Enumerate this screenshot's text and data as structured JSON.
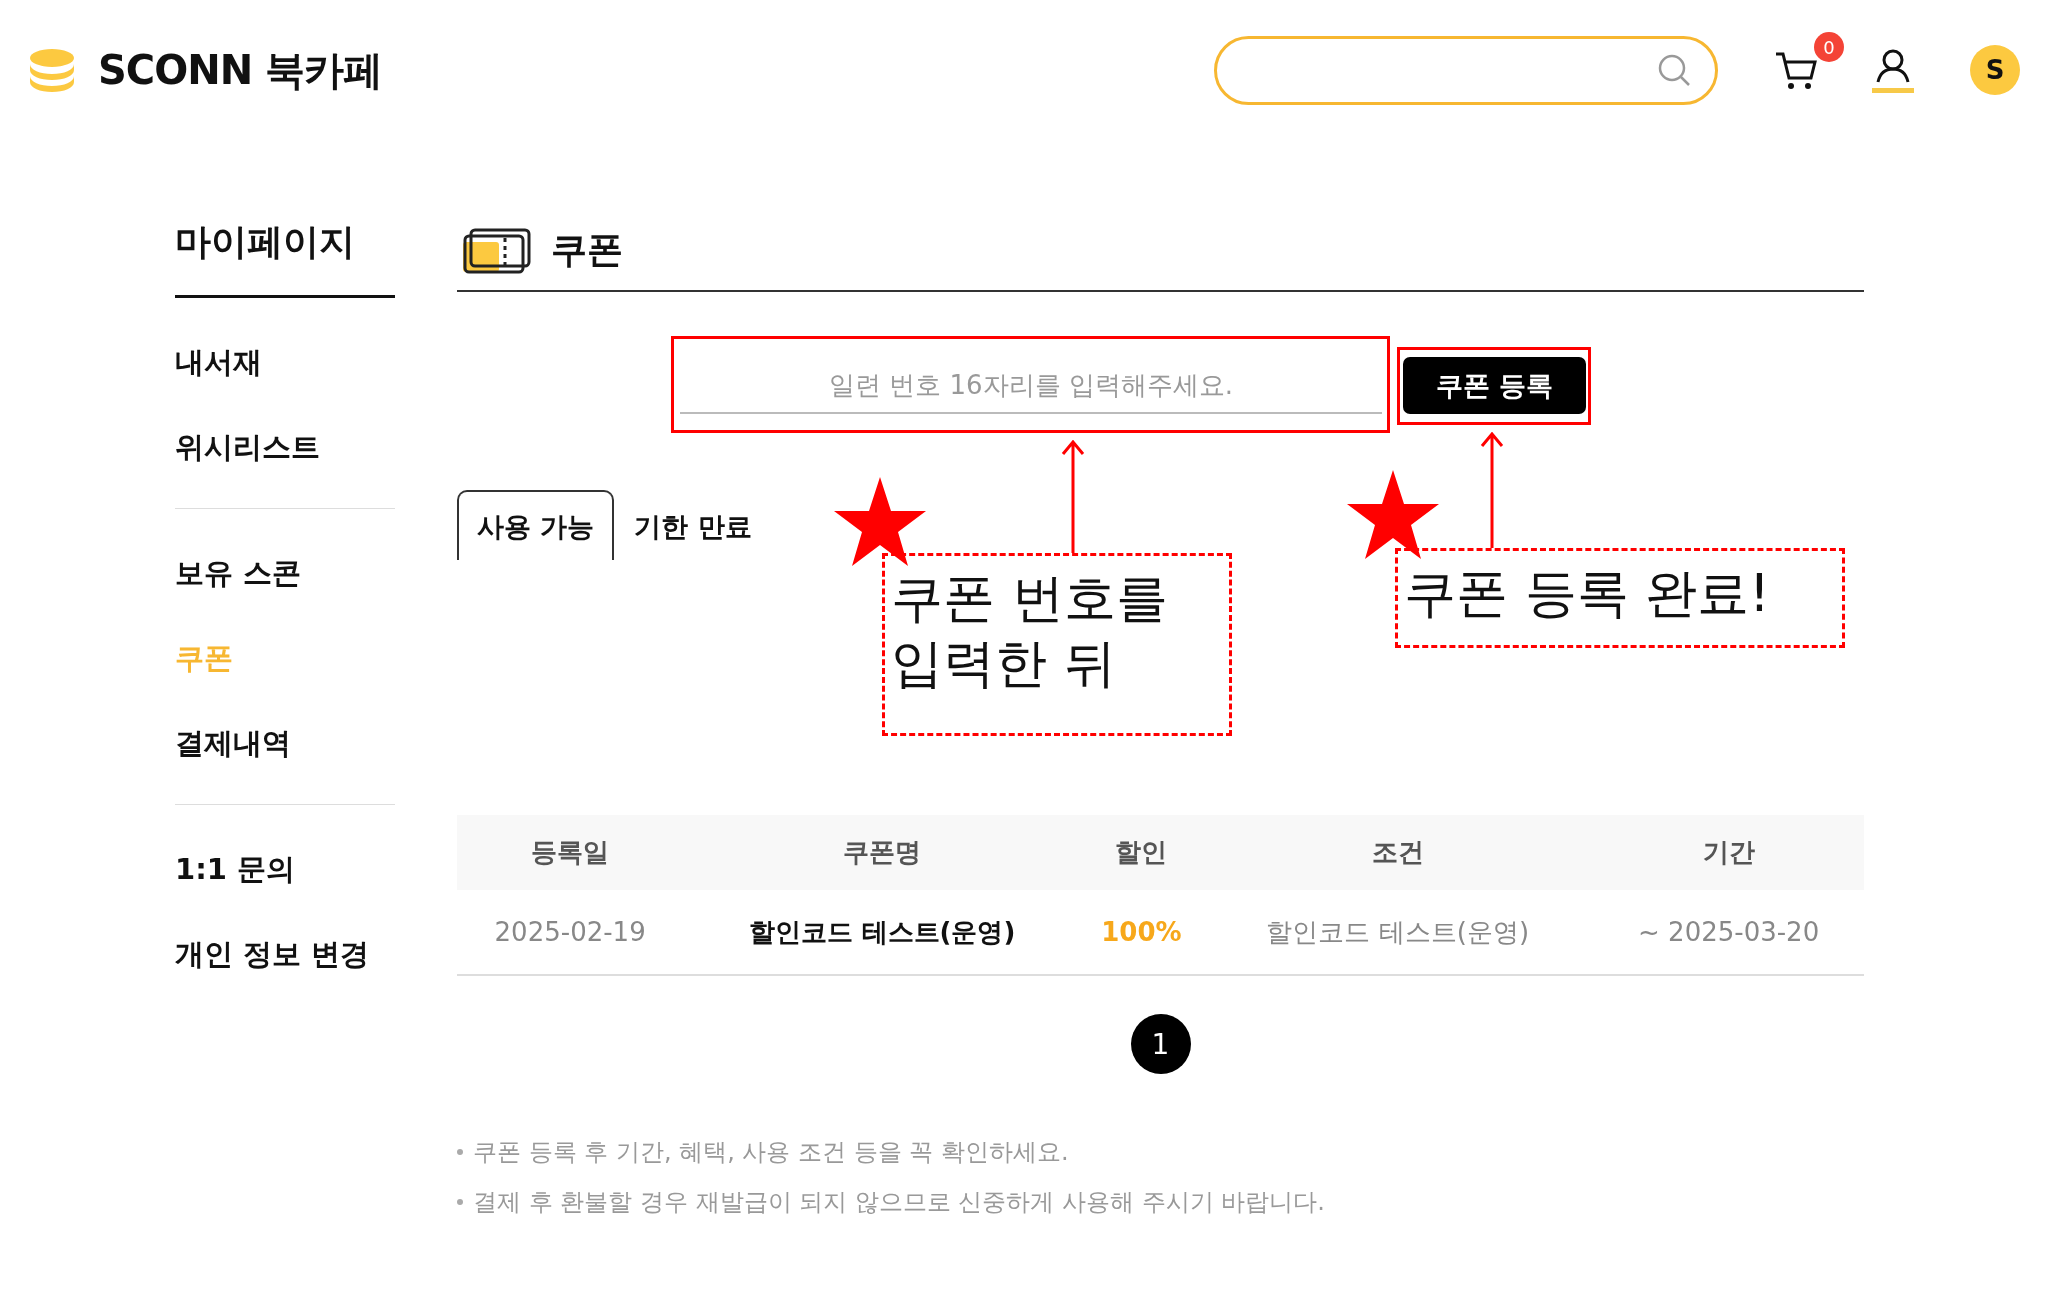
{
  "header": {
    "logo": "SCONN 북카페",
    "cart_count": "0",
    "avatar": "S"
  },
  "sidebar": {
    "title": "마이페이지",
    "groups": [
      [
        {
          "label": "내서재",
          "selected": false
        },
        {
          "label": "위시리스트",
          "selected": false
        }
      ],
      [
        {
          "label": "보유 스콘",
          "selected": false
        },
        {
          "label": "쿠폰",
          "selected": true
        },
        {
          "label": "결제내역",
          "selected": false
        }
      ],
      [
        {
          "label": "1:1 문의",
          "selected": false
        },
        {
          "label": "개인 정보 변경",
          "selected": false
        }
      ]
    ]
  },
  "page_title": "쿠폰",
  "coupon_form": {
    "placeholder": "일련 번호 16자리를 입력해주세요.",
    "button": "쿠폰 등록"
  },
  "tabs": [
    {
      "label": "사용 가능",
      "selected": true
    },
    {
      "label": "기한 만료",
      "selected": false
    }
  ],
  "table": {
    "columns": [
      "등록일",
      "쿠폰명",
      "할인",
      "조건",
      "기간"
    ],
    "rows": [
      {
        "cells": [
          "2025-02-19",
          "할인코드 테스트(운영)",
          "100%",
          "할인코드 테스트(운영)",
          "~ 2025-03-20"
        ]
      }
    ]
  },
  "pagination": [
    {
      "label": "1",
      "selected": true
    }
  ],
  "notes": [
    "쿠폰 등록 후 기간, 혜택, 사용 조건 등을 꼭 확인하세요.",
    "결제 후 환불할 경우 재발급이 되지 않으므로 신중하게 사용해 주시기 바랍니다."
  ],
  "annotations": [
    {
      "text": "쿠폰 번호를\n입력한 뒤"
    },
    {
      "text": "쿠폰 등록 완료!"
    }
  ]
}
